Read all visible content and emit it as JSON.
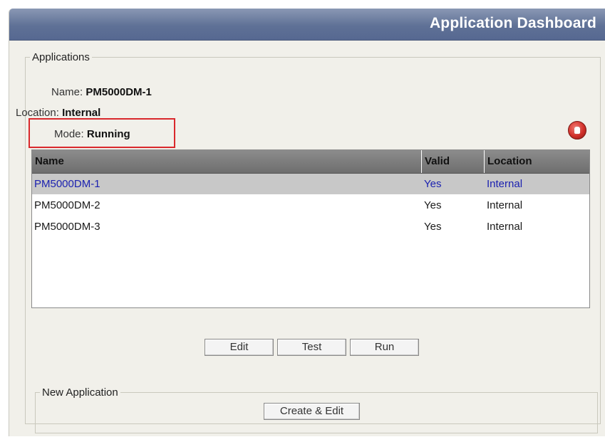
{
  "window": {
    "title": "Application Dashboard"
  },
  "applications_group": {
    "legend": "Applications",
    "details": {
      "name_label": "Name:",
      "name_value": "PM5000DM-1",
      "location_label": "Location:",
      "location_value": "Internal",
      "mode_label": "Mode:",
      "mode_value": "Running"
    },
    "stop_icon": "stop-hand-icon",
    "table": {
      "columns": [
        "Name",
        "Valid",
        "Location"
      ],
      "rows": [
        {
          "name": "PM5000DM-1",
          "valid": "Yes",
          "location": "Internal",
          "selected": true
        },
        {
          "name": "PM5000DM-2",
          "valid": "Yes",
          "location": "Internal",
          "selected": false
        },
        {
          "name": "PM5000DM-3",
          "valid": "Yes",
          "location": "Internal",
          "selected": false
        }
      ]
    },
    "buttons": {
      "edit": "Edit",
      "test": "Test",
      "run": "Run"
    }
  },
  "new_application_group": {
    "legend": "New Application",
    "create_button": "Create & Edit"
  },
  "colors": {
    "title_bar": "#5f7196",
    "highlight_box": "#d9282c",
    "selected_row_text": "#1c22b0",
    "stop_button": "#d1302a"
  }
}
